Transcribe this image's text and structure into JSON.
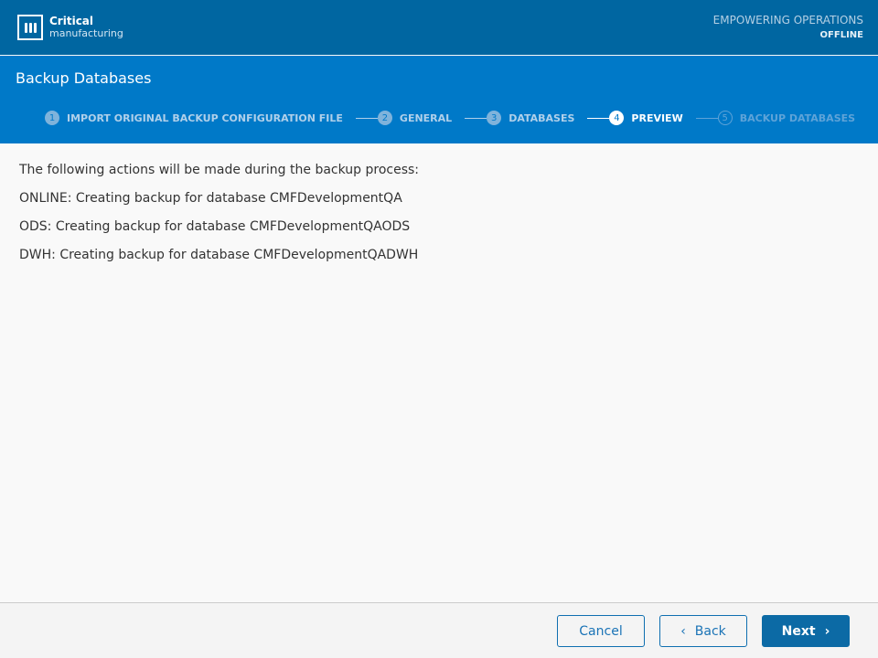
{
  "header": {
    "brand_bold": "Critical",
    "brand_light": "manufacturing",
    "tagline": "EMPOWERING OPERATIONS",
    "status": "OFFLINE"
  },
  "wizard": {
    "title": "Backup Databases",
    "steps": [
      {
        "num": "1",
        "label": "IMPORT ORIGINAL BACKUP CONFIGURATION FILE",
        "state": "done"
      },
      {
        "num": "2",
        "label": "GENERAL",
        "state": "done"
      },
      {
        "num": "3",
        "label": "DATABASES",
        "state": "done"
      },
      {
        "num": "4",
        "label": "PREVIEW",
        "state": "active"
      },
      {
        "num": "5",
        "label": "BACKUP DATABASES",
        "state": "future"
      }
    ]
  },
  "content": {
    "lines": [
      "The following actions will be made during the backup process:",
      "ONLINE: Creating backup for database CMFDevelopmentQA",
      "ODS: Creating backup for database CMFDevelopmentQAODS",
      "DWH: Creating backup for database CMFDevelopmentQADWH"
    ]
  },
  "footer": {
    "cancel": "Cancel",
    "back": "Back",
    "next": "Next",
    "back_icon": "chevron-left",
    "next_icon": "chevron-right"
  },
  "colors": {
    "header": "#0066a1",
    "band": "#0079c8",
    "primary": "#0c6aa5"
  }
}
